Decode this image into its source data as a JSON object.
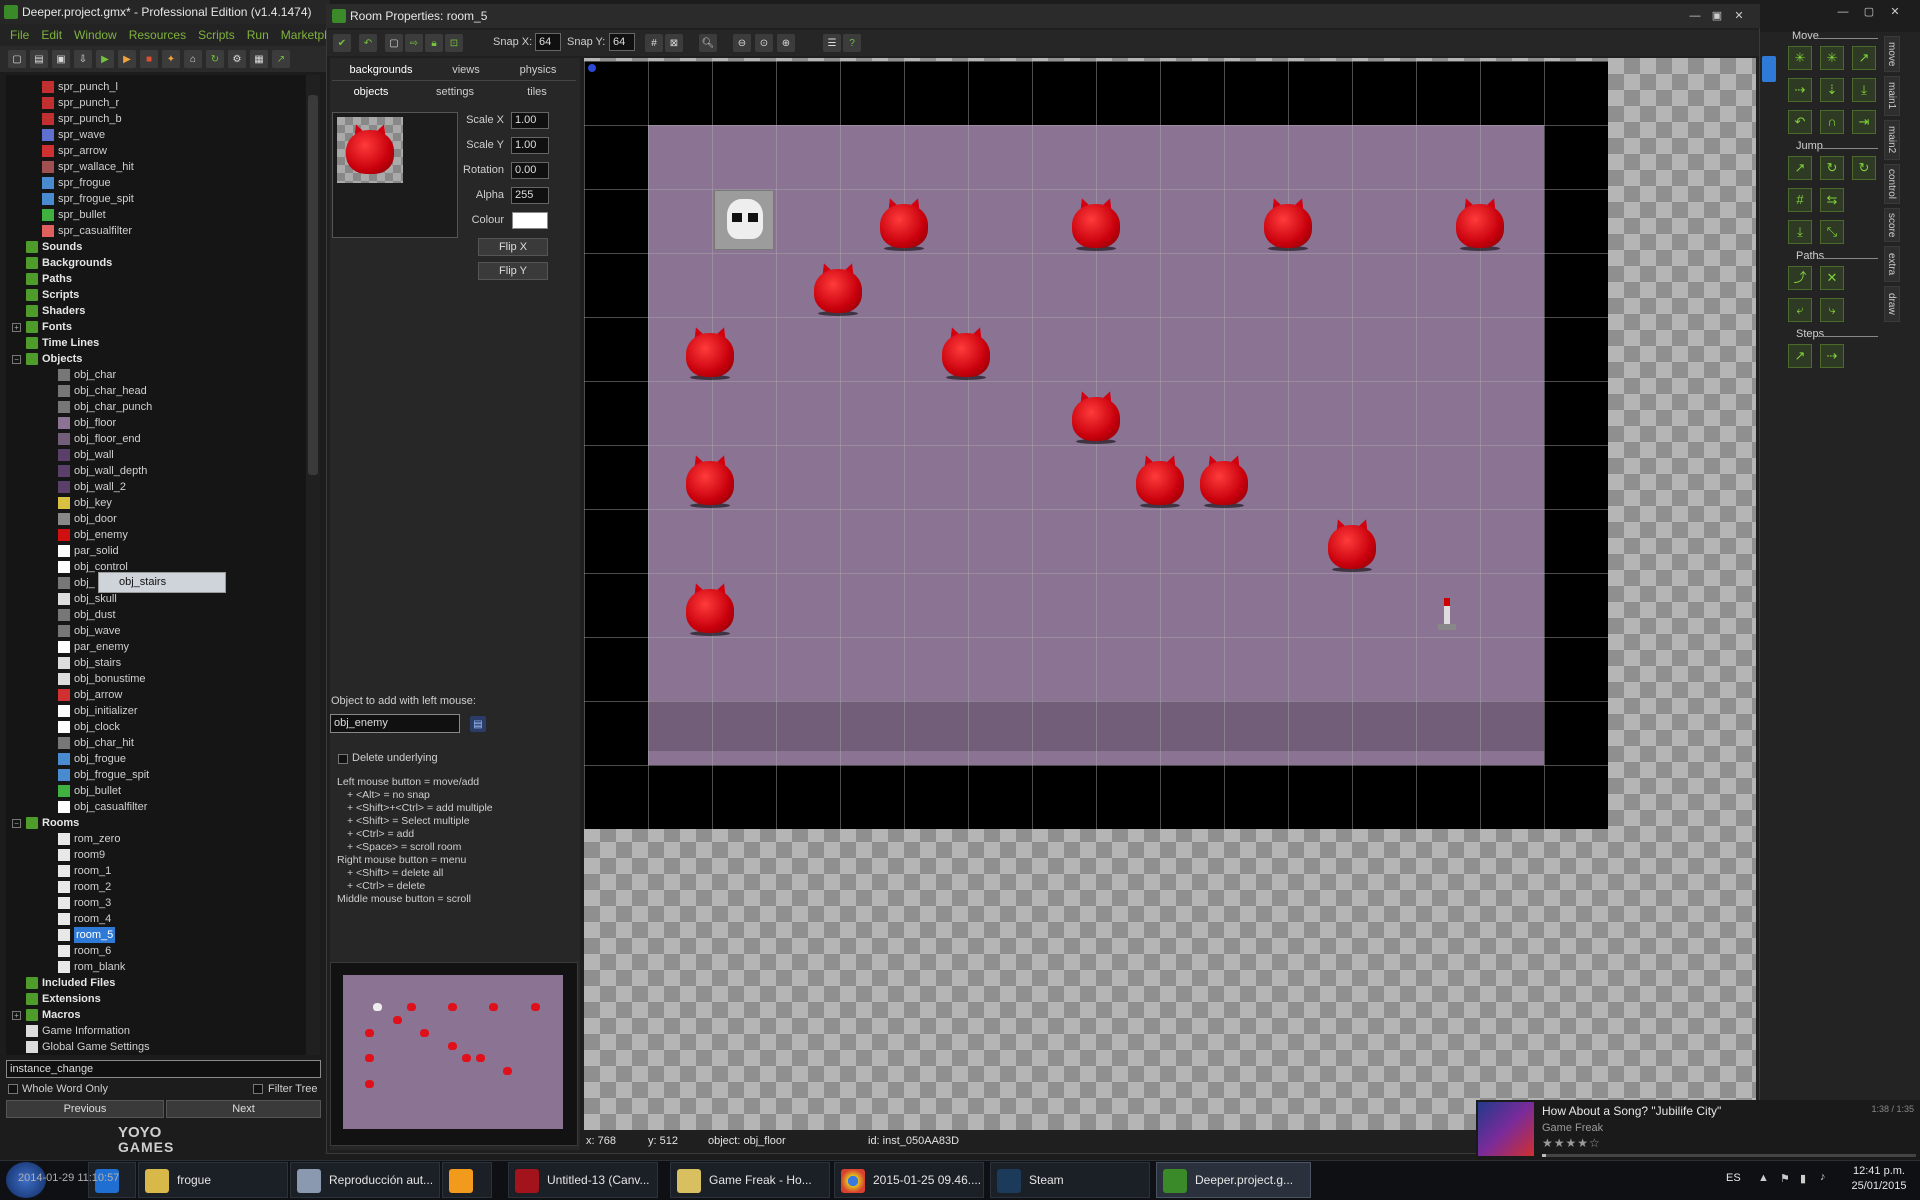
{
  "main_window": {
    "title": "Deeper.project.gmx* - Professional Edition (v1.4.1474)",
    "menu": [
      "File",
      "Edit",
      "Window",
      "Resources",
      "Scripts",
      "Run",
      "Marketplace"
    ]
  },
  "tree": {
    "sprites": [
      "spr_punch_l",
      "spr_punch_r",
      "spr_punch_b",
      "spr_wave",
      "spr_arrow",
      "spr_wallace_hit",
      "spr_frogue",
      "spr_frogue_spit",
      "spr_bullet",
      "spr_casualfilter"
    ],
    "groups_top": [
      "Sounds",
      "Backgrounds",
      "Paths",
      "Scripts",
      "Shaders",
      "Fonts",
      "Time Lines",
      "Objects"
    ],
    "objects": [
      "obj_char",
      "obj_char_head",
      "obj_char_punch",
      "obj_floor",
      "obj_floor_end",
      "obj_wall",
      "obj_wall_depth",
      "obj_wall_2",
      "obj_key",
      "obj_door",
      "obj_enemy",
      "par_solid",
      "obj_control",
      "obj_",
      "obj_skull",
      "obj_dust",
      "obj_wave",
      "par_enemy",
      "obj_stairs",
      "obj_bonustime",
      "obj_arrow",
      "obj_initializer",
      "obj_clock",
      "obj_char_hit",
      "obj_frogue",
      "obj_frogue_spit",
      "obj_bullet",
      "obj_casualfilter"
    ],
    "rooms_label": "Rooms",
    "rooms": [
      "rom_zero",
      "room9",
      "room_1",
      "room_2",
      "room_3",
      "room_4",
      "room_5",
      "room_6",
      "rom_blank"
    ],
    "groups_bottom": [
      "Included Files",
      "Extensions",
      "Macros"
    ],
    "settings": [
      "Game Information",
      "Global Game Settings"
    ],
    "drag_tooltip": "obj_stairs"
  },
  "search": {
    "value": "instance_change",
    "whole_word": "Whole Word Only",
    "filter_tree": "Filter Tree",
    "previous": "Previous",
    "next": "Next"
  },
  "brand": {
    "line1": "YOYO",
    "line2": "GAMES"
  },
  "room_window": {
    "title": "Room Properties: room_5",
    "snap_x_label": "Snap X:",
    "snap_x": "64",
    "snap_y_label": "Snap Y:",
    "snap_y": "64"
  },
  "tabs": {
    "row1": [
      "backgrounds",
      "views",
      "physics"
    ],
    "row2": [
      "objects",
      "settings",
      "tiles"
    ]
  },
  "props": {
    "scale_x_label": "Scale X",
    "scale_x": "1.00",
    "scale_y_label": "Scale Y",
    "scale_y": "1.00",
    "rotation_label": "Rotation",
    "rotation": "0.00",
    "alpha_label": "Alpha",
    "alpha": "255",
    "colour_label": "Colour",
    "flip_x": "Flip X",
    "flip_y": "Flip Y"
  },
  "add_object": {
    "label": "Object to add with left mouse:",
    "value": "obj_enemy",
    "delete_underlying": "Delete underlying"
  },
  "help_lines": [
    "Left mouse button = move/add",
    "+ <Alt> = no snap",
    "+ <Shift>+<Ctrl> = add multiple",
    "+ <Shift> = Select multiple",
    "+ <Ctrl> = add",
    "+ <Space> = scroll room",
    "Right mouse button = menu",
    "+ <Shift> = delete all",
    "+ <Ctrl> = delete",
    "Middle mouse button = scroll"
  ],
  "status": {
    "x": "x: 768",
    "y": "y: 512",
    "object": "object: obj_floor",
    "id": "id: inst_050AA83D"
  },
  "right_panel": {
    "sections": [
      "Move",
      "Jump",
      "Paths",
      "Steps"
    ],
    "tabs": [
      "move",
      "main1",
      "main2",
      "control",
      "score",
      "extra",
      "draw"
    ]
  },
  "notification": {
    "title": "How About a Song? \"Jubilife City\"",
    "artist": "Game Freak",
    "time": "1:38 / 1:35",
    "stars": "★★★★☆",
    "progress": 0.01
  },
  "taskbar": {
    "overlay": "2014-01-29 11:10:57",
    "items": [
      "frogue",
      "Reproducción aut...",
      "",
      "Untitled-13 (Canv...",
      "Game Freak - Ho...",
      "2015-01-25 09.46....",
      "Steam",
      "Deeper.project.g..."
    ],
    "lang": "ES",
    "time": "12:41 p.m.",
    "date": "25/01/2015"
  },
  "colors": {
    "accent_green": "#74c13b",
    "selection": "#2f7ad6",
    "room_floor": "#8a7393"
  }
}
